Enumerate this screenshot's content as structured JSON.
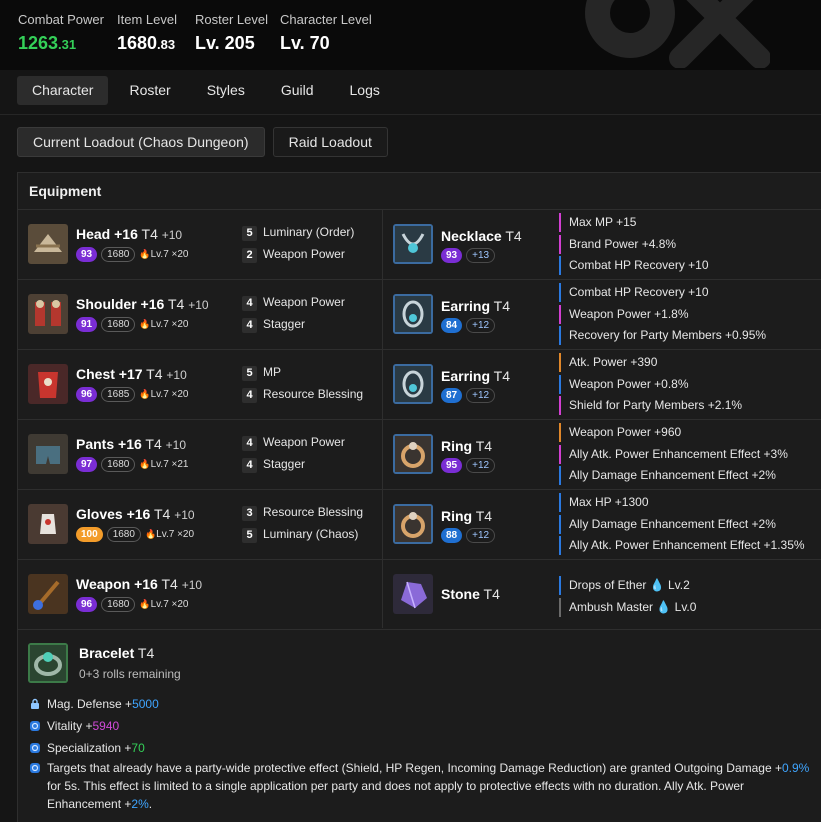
{
  "header": {
    "stats": [
      {
        "label": "Combat Power",
        "int": "1263",
        "dec": ".31"
      },
      {
        "label": "Item Level",
        "int": "1680",
        "dec": ".83"
      },
      {
        "label": "Roster Level",
        "int": "Lv. 205",
        "dec": ""
      },
      {
        "label": "Character Level",
        "int": "Lv. 70",
        "dec": ""
      }
    ],
    "accent_color": "#34d058"
  },
  "tabs": [
    "Character",
    "Roster",
    "Styles",
    "Guild",
    "Logs"
  ],
  "loadouts": [
    "Current Loadout (Chaos Dungeon)",
    "Raid Loadout"
  ],
  "equipment": {
    "title": "Equipment",
    "gear": [
      {
        "slot": "Head",
        "upgrade": "+16",
        "tier": "T4",
        "refine": "+10",
        "quality": "93",
        "qcolor": "purple",
        "ilvl": "1680",
        "ench": "Lv.7 ×20",
        "engravings": [
          {
            "n": "5",
            "name": "Luminary (Order)"
          },
          {
            "n": "2",
            "name": "Weapon Power"
          }
        ],
        "icon": "helmet-icon"
      },
      {
        "slot": "Shoulder",
        "upgrade": "+16",
        "tier": "T4",
        "refine": "+10",
        "quality": "91",
        "qcolor": "purple",
        "ilvl": "1680",
        "ench": "Lv.7 ×20",
        "engravings": [
          {
            "n": "4",
            "name": "Weapon Power"
          },
          {
            "n": "4",
            "name": "Stagger"
          }
        ],
        "icon": "shoulder-icon"
      },
      {
        "slot": "Chest",
        "upgrade": "+17",
        "tier": "T4",
        "refine": "+10",
        "quality": "96",
        "qcolor": "purple",
        "ilvl": "1685",
        "ench": "Lv.7 ×20",
        "engravings": [
          {
            "n": "5",
            "name": "MP"
          },
          {
            "n": "4",
            "name": "Resource Blessing"
          }
        ],
        "icon": "chest-icon"
      },
      {
        "slot": "Pants",
        "upgrade": "+16",
        "tier": "T4",
        "refine": "+10",
        "quality": "97",
        "qcolor": "purple",
        "ilvl": "1680",
        "ench": "Lv.7 ×21",
        "engravings": [
          {
            "n": "4",
            "name": "Weapon Power"
          },
          {
            "n": "4",
            "name": "Stagger"
          }
        ],
        "icon": "pants-icon"
      },
      {
        "slot": "Gloves",
        "upgrade": "+16",
        "tier": "T4",
        "refine": "+10",
        "quality": "100",
        "qcolor": "orange",
        "ilvl": "1680",
        "ench": "Lv.7 ×20",
        "engravings": [
          {
            "n": "3",
            "name": "Resource Blessing"
          },
          {
            "n": "5",
            "name": "Luminary (Chaos)"
          }
        ],
        "icon": "gloves-icon"
      },
      {
        "slot": "Weapon",
        "upgrade": "+16",
        "tier": "T4",
        "refine": "+10",
        "quality": "96",
        "qcolor": "purple",
        "ilvl": "1680",
        "ench": "Lv.7 ×20",
        "engravings": [],
        "icon": "weapon-icon"
      }
    ],
    "accessories": [
      {
        "name": "Necklace",
        "tier": "T4",
        "quality": "93",
        "qcolor": "purple",
        "bonus": "+13",
        "effects": [
          {
            "text": "Max MP +15",
            "c": "pink"
          },
          {
            "text": "Brand Power +4.8%",
            "c": "pink"
          },
          {
            "text": "Combat HP Recovery +10",
            "c": "blue"
          }
        ],
        "icon": "necklace-icon"
      },
      {
        "name": "Earring",
        "tier": "T4",
        "quality": "84",
        "qcolor": "blue",
        "bonus": "+12",
        "effects": [
          {
            "text": "Combat HP Recovery +10",
            "c": "blue"
          },
          {
            "text": "Weapon Power +1.8%",
            "c": "pink"
          },
          {
            "text": "Recovery for Party Members +0.95%",
            "c": "blue"
          }
        ],
        "icon": "earring-icon"
      },
      {
        "name": "Earring",
        "tier": "T4",
        "quality": "87",
        "qcolor": "blue",
        "bonus": "+12",
        "effects": [
          {
            "text": "Atk. Power +390",
            "c": "orange"
          },
          {
            "text": "Weapon Power +0.8%",
            "c": "blue"
          },
          {
            "text": "Shield for Party Members +2.1%",
            "c": "pink"
          }
        ],
        "icon": "earring-icon"
      },
      {
        "name": "Ring",
        "tier": "T4",
        "quality": "95",
        "qcolor": "purple",
        "bonus": "+12",
        "effects": [
          {
            "text": "Weapon Power +960",
            "c": "orange"
          },
          {
            "text": "Ally Atk. Power Enhancement Effect +3%",
            "c": "pink"
          },
          {
            "text": "Ally Damage Enhancement Effect +2%",
            "c": "blue"
          }
        ],
        "icon": "ring-icon"
      },
      {
        "name": "Ring",
        "tier": "T4",
        "quality": "88",
        "qcolor": "blue",
        "bonus": "+12",
        "effects": [
          {
            "text": "Max HP +1300",
            "c": "blue"
          },
          {
            "text": "Ally Damage Enhancement Effect +2%",
            "c": "blue"
          },
          {
            "text": "Ally Atk. Power Enhancement Effect +1.35%",
            "c": "blue"
          }
        ],
        "icon": "ring-icon"
      },
      {
        "name": "Stone",
        "tier": "T4",
        "quality": "",
        "bonus": "",
        "effects": [
          {
            "text": "Drops of Ether",
            "lv": "Lv.2",
            "c": "blue"
          },
          {
            "text": "Ambush Master",
            "lv": "Lv.0",
            "c": "grey"
          }
        ],
        "icon": "stone-icon"
      }
    ]
  },
  "bracelet": {
    "name": "Bracelet",
    "tier": "T4",
    "rolls": "0+3 rolls remaining",
    "stats": [
      {
        "label": "Mag. Defense +",
        "value": "5000",
        "color": "blue",
        "icon": "lock-icon"
      },
      {
        "label": "Vitality +",
        "value": "5940",
        "color": "pink",
        "icon": "gear-icon"
      },
      {
        "label": "Specialization +",
        "value": "70",
        "color": "green",
        "icon": "gear-icon"
      }
    ],
    "effect": {
      "p1": "Targets that already have a party-wide protective effect (Shield, HP Regen, Incoming Damage Reduction) are granted Outgoing Damage +",
      "v1": "0.9%",
      "p2": " for 5s. This effect is limited to a single application per party and does not apply to protective effects with no duration. Ally Atk. Power Enhancement +",
      "v2": "2%",
      "p3": "."
    }
  }
}
